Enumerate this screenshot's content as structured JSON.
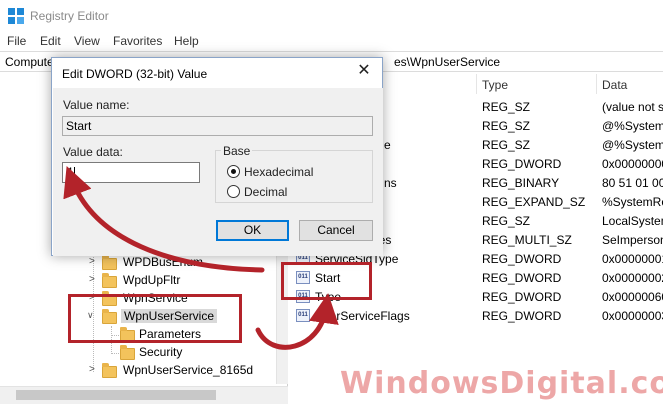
{
  "window": {
    "title": "Registry Editor"
  },
  "menu": [
    "File",
    "Edit",
    "View",
    "Favorites",
    "Help"
  ],
  "address": {
    "left": "Compute",
    "right": "es\\WpnUserService"
  },
  "tree": {
    "rows": [
      {
        "label": "WPDBusEnum"
      },
      {
        "label": "WpdUpFltr"
      },
      {
        "label": "WpnService"
      },
      {
        "label": "WpnUserService"
      },
      {
        "label": "Parameters"
      },
      {
        "label": "Security"
      },
      {
        "label": "WpnUserService_8165d"
      }
    ]
  },
  "list": {
    "headers": {
      "type": "Type",
      "data": "Data"
    },
    "rows": [
      {
        "name": "",
        "type": "REG_SZ",
        "data": "(value not s"
      },
      {
        "name": "",
        "type": "REG_SZ",
        "data": "@%SystemR"
      },
      {
        "name": "e",
        "type": "REG_SZ",
        "data": "@%SystemR"
      },
      {
        "name": "",
        "type": "REG_DWORD",
        "data": "0x00000000"
      },
      {
        "name": "ns",
        "type": "REG_BINARY",
        "data": "80 51 01 00 ("
      },
      {
        "name": "",
        "type": "REG_EXPAND_SZ",
        "data": "%SystemRo"
      },
      {
        "name": "",
        "type": "REG_SZ",
        "data": "LocalSystem"
      },
      {
        "name": "ileges",
        "type": "REG_MULTI_SZ",
        "data": "SeImperson"
      },
      {
        "name": "ServiceSidType",
        "type": "REG_DWORD",
        "data": "0x00000001"
      },
      {
        "name": "Start",
        "type": "REG_DWORD",
        "data": "0x00000002"
      },
      {
        "name": "Type",
        "type": "REG_DWORD",
        "data": "0x00000060"
      },
      {
        "name": "UserServiceFlags",
        "type": "REG_DWORD",
        "data": "0x00000003"
      }
    ],
    "value_icon_text": "011"
  },
  "dialog": {
    "title": "Edit DWORD (32-bit) Value",
    "close": "✕",
    "value_name_label": "Value name:",
    "value_name": "Start",
    "value_data_label": "Value data:",
    "value_data": "4",
    "base_label": "Base",
    "radio_hex": "Hexadecimal",
    "radio_dec": "Decimal",
    "base_selected": "Hexadecimal",
    "ok": "OK",
    "cancel": "Cancel"
  },
  "watermark": "WindowsDigital.com",
  "colors": {
    "annotation": "#b3232a",
    "accent": "#0078d7",
    "folder": "#f3c35c"
  }
}
